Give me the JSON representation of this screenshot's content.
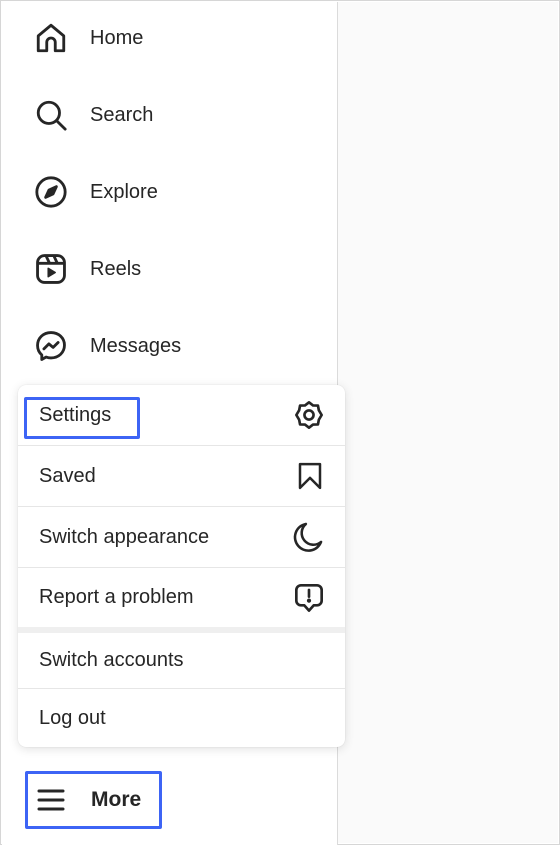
{
  "nav": {
    "items": [
      {
        "label": "Home",
        "icon": "home-icon"
      },
      {
        "label": "Search",
        "icon": "search-icon"
      },
      {
        "label": "Explore",
        "icon": "compass-icon"
      },
      {
        "label": "Reels",
        "icon": "reels-icon"
      },
      {
        "label": "Messages",
        "icon": "messenger-icon"
      }
    ]
  },
  "menu": {
    "items": [
      {
        "label": "Settings",
        "icon": "gear-icon",
        "highlighted": true
      },
      {
        "label": "Saved",
        "icon": "bookmark-icon"
      },
      {
        "label": "Switch appearance",
        "icon": "moon-icon"
      },
      {
        "label": "Report a problem",
        "icon": "report-icon"
      }
    ],
    "account_items": [
      {
        "label": "Switch accounts"
      },
      {
        "label": "Log out"
      }
    ]
  },
  "more": {
    "label": "More",
    "icon": "hamburger-menu-icon",
    "highlighted": true
  },
  "colors": {
    "highlight": "#3d64f5",
    "text": "#262626",
    "divider": "#e6e6e6"
  }
}
